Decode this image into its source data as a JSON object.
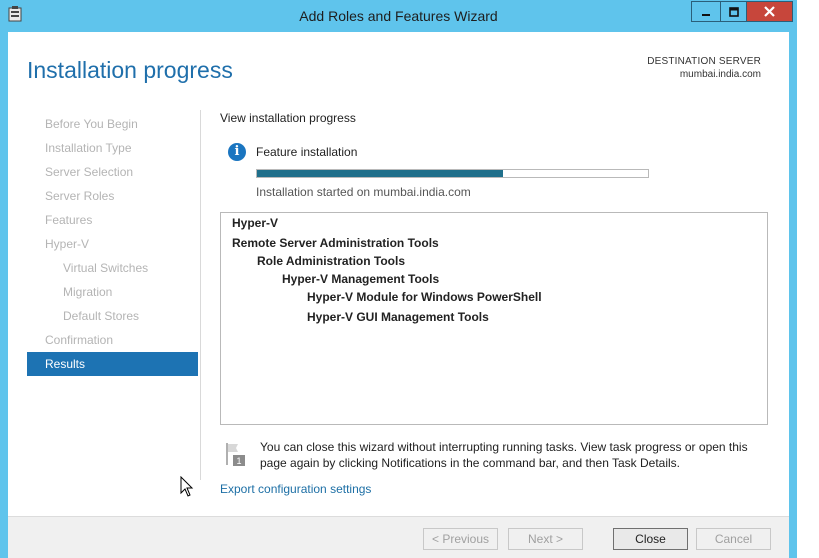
{
  "window": {
    "title": "Add Roles and Features Wizard",
    "controls": {
      "minimize": "minimize",
      "maximize": "maximize",
      "close": "close"
    }
  },
  "header": {
    "page_title": "Installation progress",
    "destination_label": "DESTINATION SERVER",
    "destination_server": "mumbai.india.com"
  },
  "nav": {
    "items": [
      {
        "label": "Before You Begin",
        "level": 0,
        "active": false
      },
      {
        "label": "Installation Type",
        "level": 0,
        "active": false
      },
      {
        "label": "Server Selection",
        "level": 0,
        "active": false
      },
      {
        "label": "Server Roles",
        "level": 0,
        "active": false
      },
      {
        "label": "Features",
        "level": 0,
        "active": false
      },
      {
        "label": "Hyper-V",
        "level": 0,
        "active": false
      },
      {
        "label": "Virtual Switches",
        "level": 1,
        "active": false
      },
      {
        "label": "Migration",
        "level": 1,
        "active": false
      },
      {
        "label": "Default Stores",
        "level": 1,
        "active": false
      },
      {
        "label": "Confirmation",
        "level": 0,
        "active": false
      },
      {
        "label": "Results",
        "level": 0,
        "active": true
      }
    ]
  },
  "main": {
    "view_label": "View installation progress",
    "feature_label": "Feature installation",
    "progress_fraction": 0.63,
    "status_text": "Installation started on mumbai.india.com",
    "results": [
      {
        "label": "Hyper-V",
        "level": 0
      },
      {
        "label": "Remote Server Administration Tools",
        "level": 0
      },
      {
        "label": "Role Administration Tools",
        "level": 1
      },
      {
        "label": "Hyper-V Management Tools",
        "level": 2
      },
      {
        "label": "Hyper-V Module for Windows PowerShell",
        "level": 3
      },
      {
        "label": "Hyper-V GUI Management Tools",
        "level": 3
      }
    ],
    "note_line1": "You can close this wizard without interrupting running tasks. View task progress or open this",
    "note_line2": "page again by clicking Notifications in the command bar, and then Task Details.",
    "export_link": "Export configuration settings"
  },
  "footer": {
    "previous_label": "< Previous",
    "next_label": "Next >",
    "close_label": "Close",
    "cancel_label": "Cancel"
  },
  "colors": {
    "title_bar": "#5fc4ec",
    "accent": "#1d73b3",
    "progress_fill": "#1f6f8b",
    "close_button": "#c7463b"
  }
}
